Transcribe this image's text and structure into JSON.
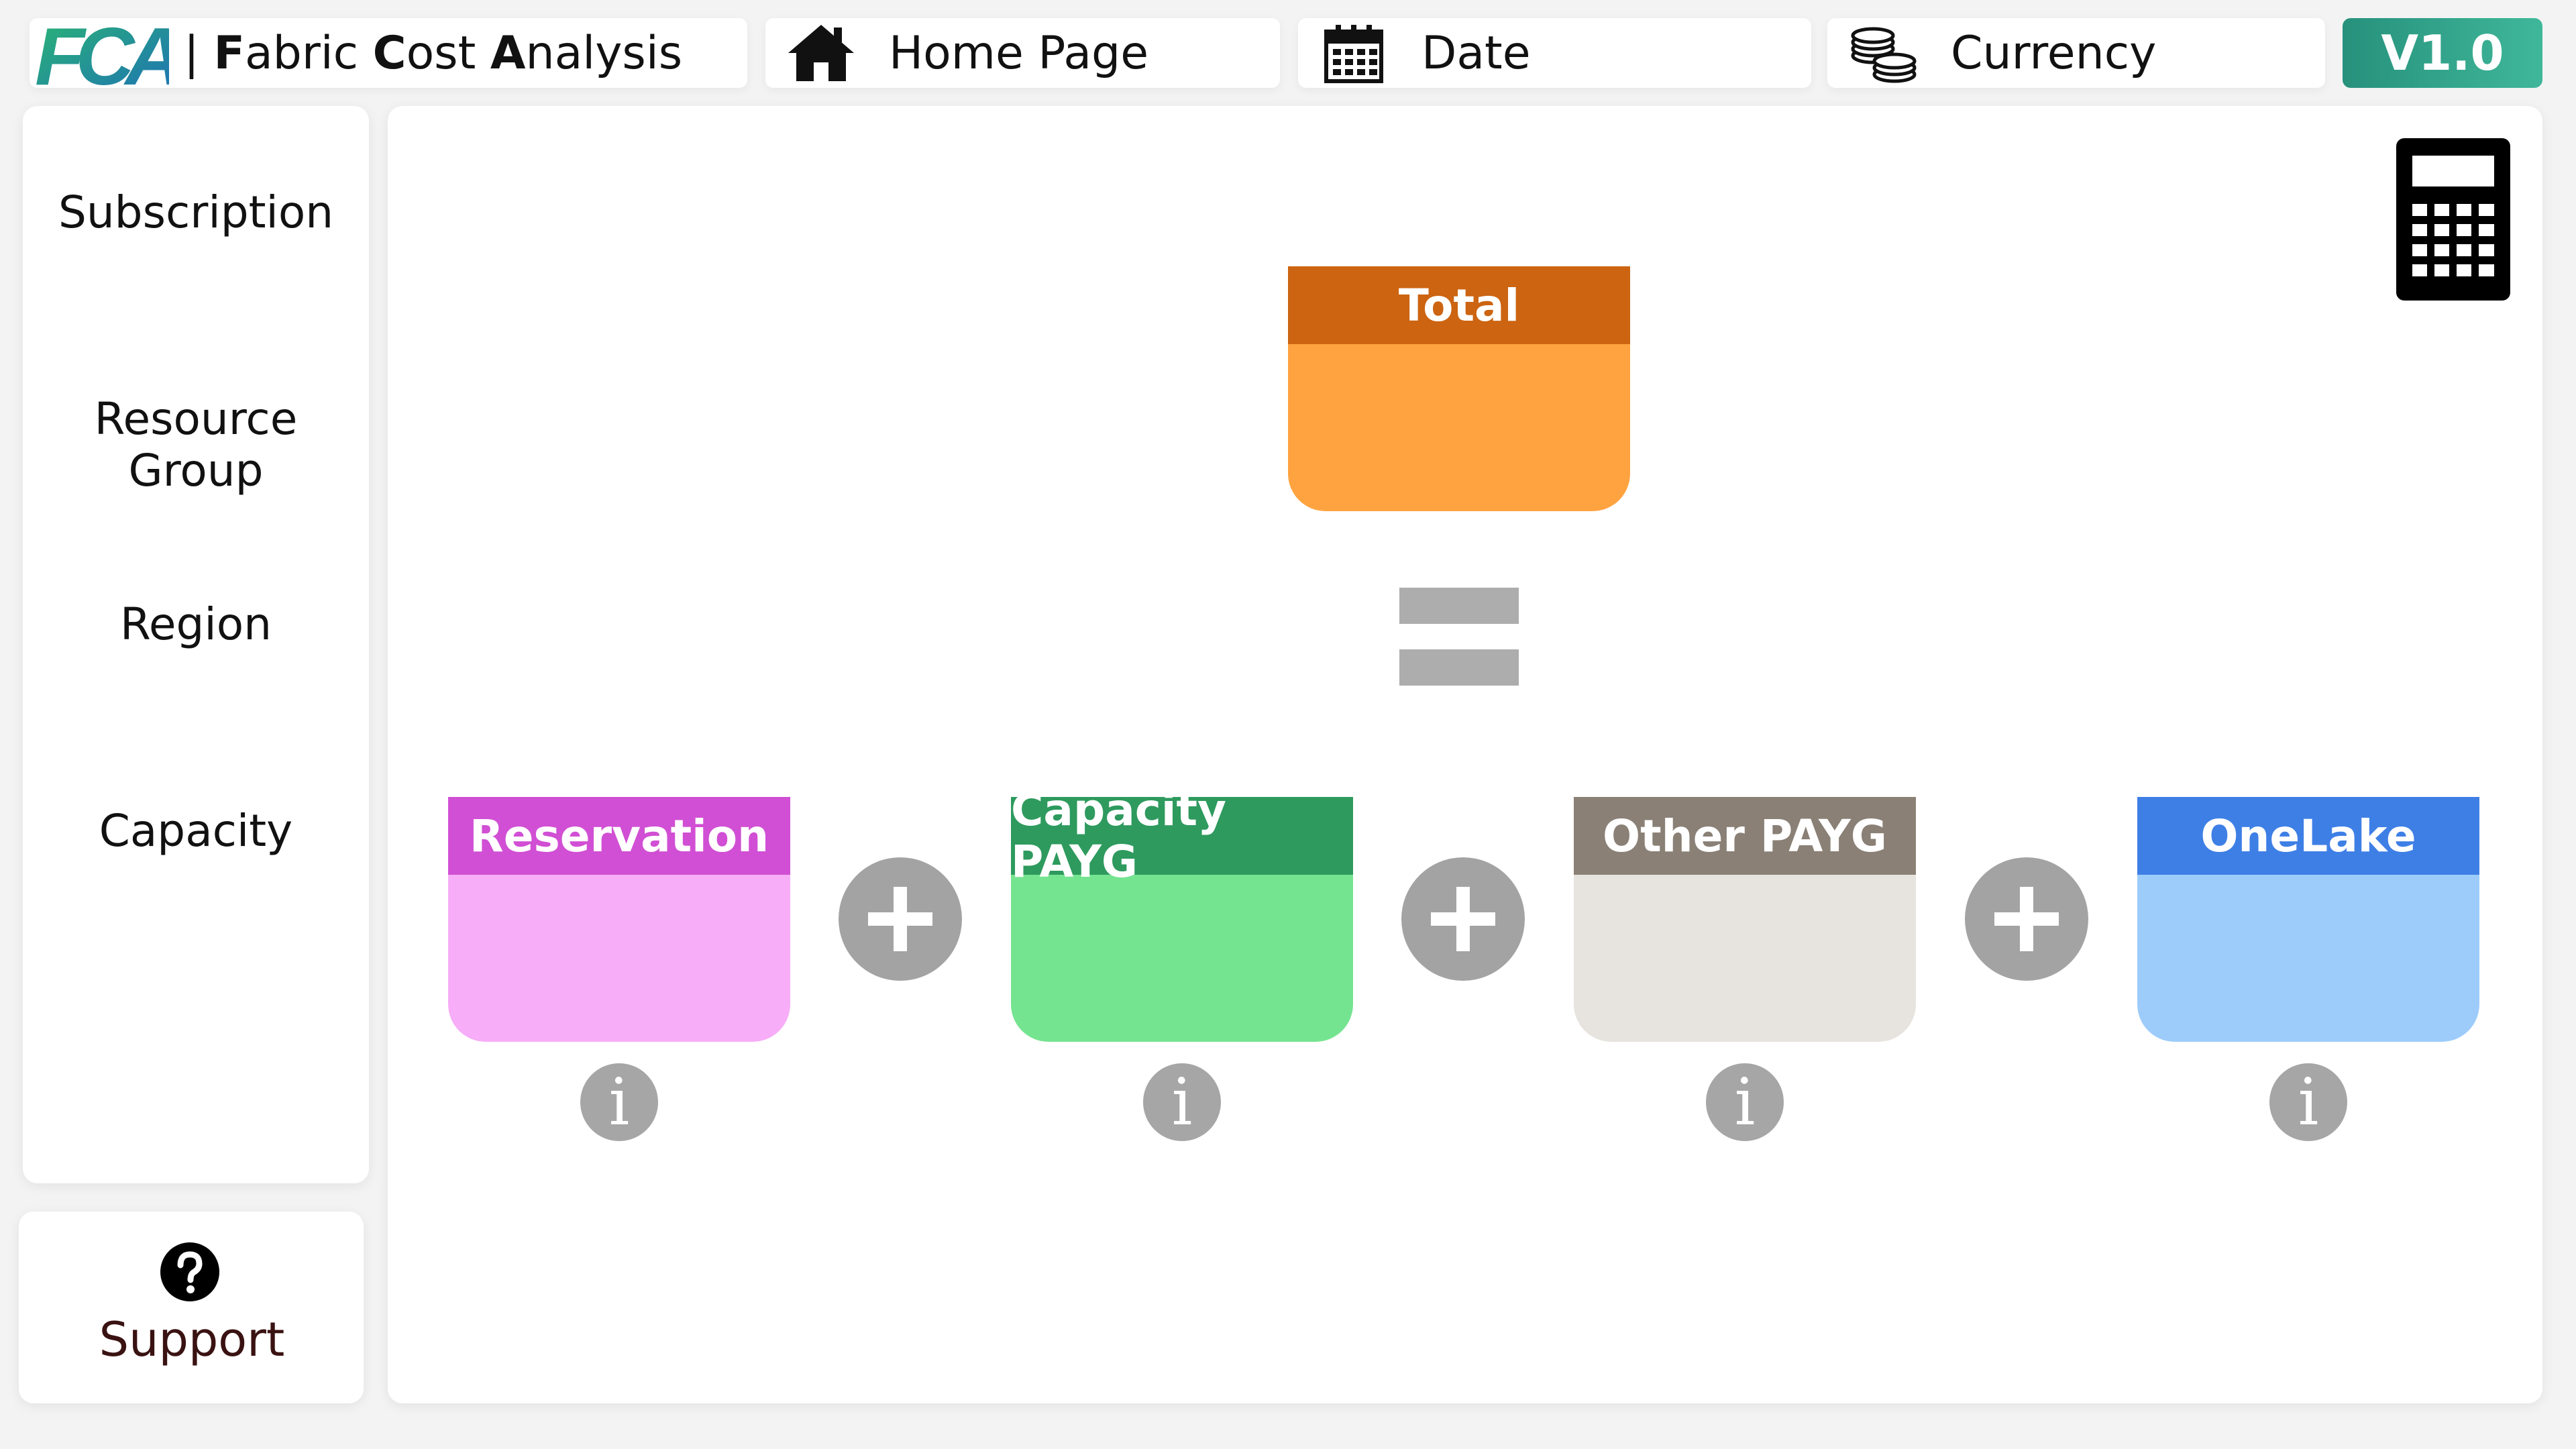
{
  "header": {
    "logo_text": "FCA",
    "title_prefix": "| ",
    "title_parts": [
      {
        "bold": "F",
        "rest": "abric "
      },
      {
        "bold": "C",
        "rest": "ost "
      },
      {
        "bold": "A",
        "rest": "nalysis"
      }
    ],
    "nav": [
      {
        "label": "Home Page",
        "icon": "home-icon"
      },
      {
        "label": "Date",
        "icon": "calendar-icon"
      },
      {
        "label": "Currency",
        "icon": "coins-icon"
      }
    ],
    "version": "V1.0"
  },
  "sidebar": {
    "items": [
      {
        "label": "Subscription"
      },
      {
        "label": "Resource Group"
      },
      {
        "label": "Region"
      },
      {
        "label": "Capacity"
      }
    ],
    "support_label": "Support"
  },
  "main": {
    "calculator_icon": "calculator-icon",
    "total_card": {
      "title": "Total",
      "header_color": "#cc6411",
      "body_color": "#ffa340"
    },
    "operators": {
      "equals": "=",
      "plus": "+"
    },
    "info_glyph": "i",
    "cards": [
      {
        "title": "Reservation",
        "header_color": "#d14fd4",
        "body_color": "#f7adf7"
      },
      {
        "title": "Capacity PAYG",
        "header_color": "#2e9a5e",
        "body_color": "#75e490"
      },
      {
        "title": "Other PAYG",
        "header_color": "#8a8076",
        "body_color": "#e7e4df"
      },
      {
        "title": "OneLake",
        "header_color": "#3e7fe6",
        "body_color": "#9dccfb"
      }
    ]
  },
  "colors": {
    "accent": "#2ea58a",
    "operator_gray": "#a3a3a3"
  }
}
